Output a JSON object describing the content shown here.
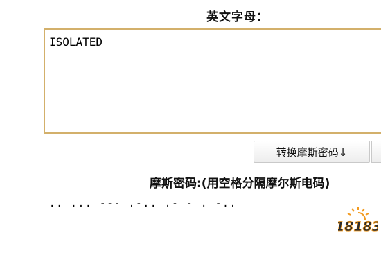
{
  "input_section": {
    "label": "英文字母：",
    "value": "ISOLATED"
  },
  "convert_button": {
    "label": "转换摩斯密码↓"
  },
  "output_section": {
    "label": "摩斯密码:(用空格分隔摩尔斯电码)",
    "value": ".. ... --- .-.. .- - . -.."
  },
  "watermark": {
    "text": "18183"
  },
  "colors": {
    "input_border": "#d3b06b",
    "watermark_orange": "#f29a1f",
    "watermark_dark": "#2b2b2b"
  }
}
